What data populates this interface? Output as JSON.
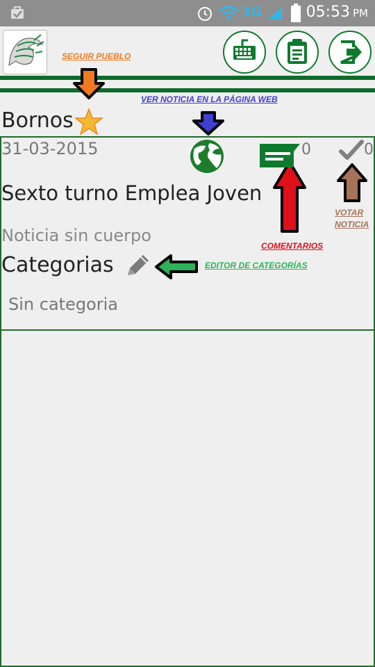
{
  "status_bar": {
    "time": "05:53",
    "ampm": "PM",
    "network": "3G"
  },
  "header": {
    "buttons": [
      {
        "icon": "keyboard-icon"
      },
      {
        "icon": "clipboard-icon"
      },
      {
        "icon": "logout-icon"
      }
    ]
  },
  "annotations": {
    "follow_town": "SEGUIR PUEBLO",
    "view_web": "VER NOTICIA EN LA PÁGINA WEB",
    "comments": "COMENTARIOS",
    "vote_line1": "VOTAR",
    "vote_line2": "NOTICIA",
    "category_editor": "EDITOR DE CATEGORÍAS"
  },
  "town": {
    "name": "Bornos"
  },
  "news": {
    "date": "31-03-2015",
    "title": "Sexto turno Emplea Joven",
    "body": "Noticia sin cuerpo",
    "comments_count": "0",
    "votes_count": "0"
  },
  "categories": {
    "heading": "Categorias",
    "value": "Sin categoria"
  },
  "colors": {
    "primary_green": "#0e7a2e",
    "orange": "#f07a22",
    "blue": "#3f3fcf",
    "red": "#e0101a",
    "brown": "#a87258",
    "light_green": "#2eb15a"
  }
}
